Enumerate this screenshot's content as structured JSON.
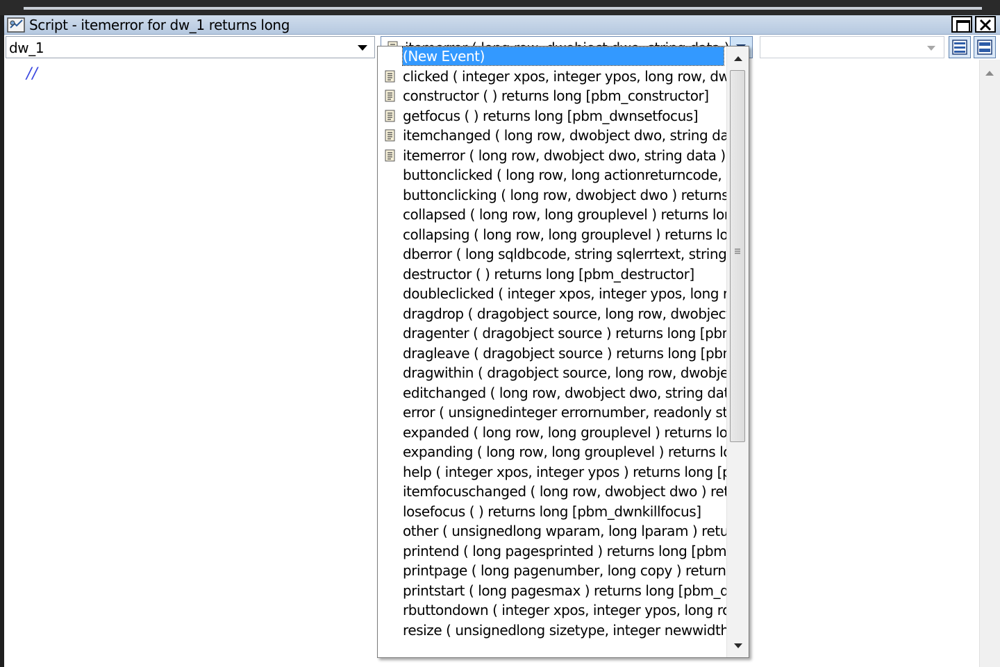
{
  "window": {
    "title": "Script - itemerror for dw_1 returns long"
  },
  "toolbar": {
    "object_value": "dw_1",
    "event_value": "itemerror ( long row, dwobject dwo, string data )",
    "ancestor_value": ""
  },
  "editor": {
    "code": "//"
  },
  "event_list": [
    {
      "label": "(New Event)",
      "icon": false,
      "selected": true
    },
    {
      "label": "clicked ( integer xpos, integer ypos, long row, dwobject dwo )",
      "icon": true
    },
    {
      "label": "constructor ( ) returns long [pbm_constructor]",
      "icon": true
    },
    {
      "label": "getfocus ( ) returns long [pbm_dwnsetfocus]",
      "icon": true
    },
    {
      "label": "itemchanged ( long row, dwobject dwo, string data )",
      "icon": true
    },
    {
      "label": "itemerror ( long row, dwobject dwo, string data )",
      "icon": true
    },
    {
      "label": "buttonclicked ( long row, long actionreturncode, dwobject dwo )",
      "icon": false
    },
    {
      "label": "buttonclicking ( long row, dwobject dwo ) returns long",
      "icon": false
    },
    {
      "label": "collapsed ( long row, long grouplevel ) returns long",
      "icon": false
    },
    {
      "label": "collapsing ( long row, long grouplevel ) returns long",
      "icon": false
    },
    {
      "label": "dberror ( long sqldbcode, string sqlerrtext, string sqlsyntax )",
      "icon": false
    },
    {
      "label": "destructor ( ) returns long [pbm_destructor]",
      "icon": false
    },
    {
      "label": "doubleclicked ( integer xpos, integer ypos, long row, dwobject dwo )",
      "icon": false
    },
    {
      "label": "dragdrop ( dragobject source, long row, dwobject dwo )",
      "icon": false
    },
    {
      "label": "dragenter ( dragobject source ) returns long [pbm_dragenter]",
      "icon": false
    },
    {
      "label": "dragleave ( dragobject source ) returns long [pbm_dragleave]",
      "icon": false
    },
    {
      "label": "dragwithin ( dragobject source, long row, dwobject dwo )",
      "icon": false
    },
    {
      "label": "editchanged ( long row, dwobject dwo, string data )",
      "icon": false
    },
    {
      "label": "error ( unsignedinteger errornumber, readonly string errortext )",
      "icon": false
    },
    {
      "label": "expanded ( long row, long grouplevel ) returns long",
      "icon": false
    },
    {
      "label": "expanding ( long row, long grouplevel ) returns long",
      "icon": false
    },
    {
      "label": "help ( integer xpos, integer ypos ) returns long [pbm_help]",
      "icon": false
    },
    {
      "label": "itemfocuschanged ( long row, dwobject dwo ) returns long",
      "icon": false
    },
    {
      "label": "losefocus ( ) returns long [pbm_dwnkillfocus]",
      "icon": false
    },
    {
      "label": "other ( unsignedlong wparam, long lparam ) returns long",
      "icon": false
    },
    {
      "label": "printend ( long pagesprinted ) returns long [pbm_dwnprintend]",
      "icon": false
    },
    {
      "label": "printpage ( long pagenumber, long copy ) returns long",
      "icon": false
    },
    {
      "label": "printstart ( long pagesmax ) returns long [pbm_dwnprintstart]",
      "icon": false
    },
    {
      "label": "rbuttondown ( integer xpos, integer ypos, long row, dwobject dwo )",
      "icon": false
    },
    {
      "label": "resize ( unsignedlong sizetype, integer newwidth, integer newheight )",
      "icon": false
    }
  ],
  "colors": {
    "selection": "#3399ff",
    "comment": "#3b48e0",
    "titlebar": "#b6c9e0"
  }
}
